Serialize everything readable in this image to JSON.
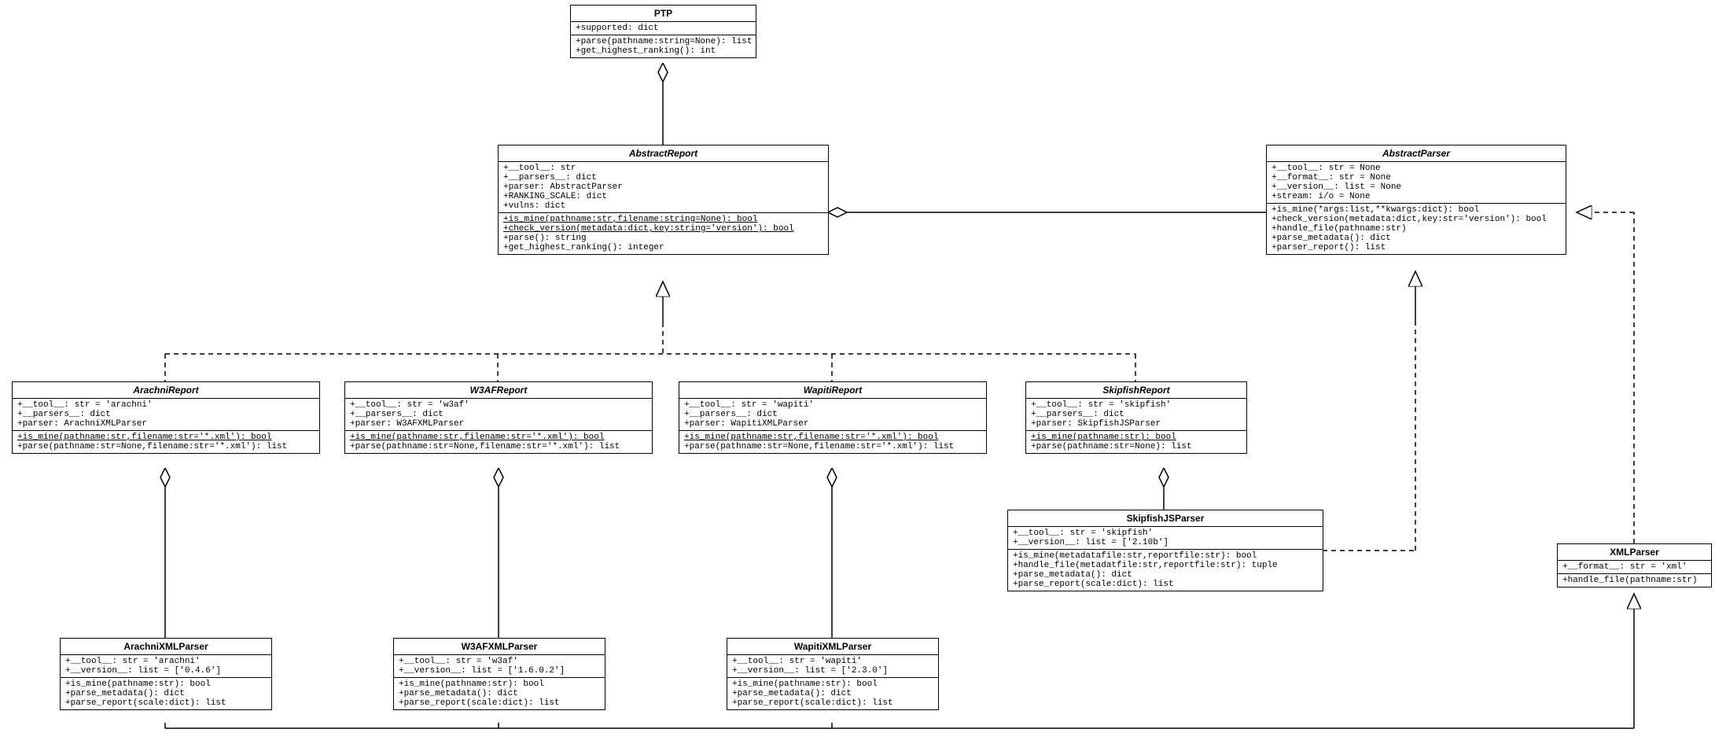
{
  "ptp": {
    "name": "PTP",
    "attrs": "+supported: dict",
    "methods": "+parse(pathname:string=None): list\n+get_highest_ranking(): int"
  },
  "abstractReport": {
    "name": "AbstractReport",
    "attrs": "+__tool__: str\n+__parsers__: dict\n+parser: AbstractParser\n+RANKING_SCALE: dict\n+vulns: dict",
    "methods1": "+is_mine(pathname:str,filename:string=None): bool\n+check_version(metadata:dict,key:string='version'): bool",
    "methods2": "+parse(): string\n+get_highest_ranking(): integer"
  },
  "abstractParser": {
    "name": "AbstractParser",
    "attrs": "+__tool__: str = None\n+__format__: str = None\n+__version__: list = None\n+stream: i/o = None",
    "methods": "+is_mine(*args:list,**kwargs:dict): bool\n+check_version(metadata:dict,key:str='version'): bool\n+handle_file(pathname:str)\n+parse_metadata(): dict\n+parser_report(): list"
  },
  "arachniReport": {
    "name": "ArachniReport",
    "attrs": "+__tool__: str = 'arachni'\n+__parsers__: dict\n+parser: ArachniXMLParser",
    "method1": "+is_mine(pathname:str,filename:str='*.xml'): bool",
    "method2": "+parse(pathname:str=None,filename:str='*.xml'): list"
  },
  "w3afReport": {
    "name": "W3AFReport",
    "attrs": "+__tool__: str = 'w3af'\n+__parsers__: dict\n+parser: W3AFXMLParser",
    "method1": "+is_mine(pathname:str,filename:str='*.xml'): bool",
    "method2": "+parse(pathname:str=None,filename:str='*.xml'): list"
  },
  "wapitiReport": {
    "name": "WapitiReport",
    "attrs": "+__tool__: str = 'wapiti'\n+__parsers__: dict\n+parser: WapitiXMLParser",
    "method1": "+is_mine(pathname:str,filename:str='*.xml'): bool",
    "method2": "+parse(pathname:str=None,filename:str='*.xml'): list"
  },
  "skipfishReport": {
    "name": "SkipfishReport",
    "attrs": "+__tool__: str = 'skipfish'\n+__parsers__: dict\n+parser: SkipfishJSParser",
    "method1": "+is_mine(pathname:str): bool",
    "method2": "+parse(pathname:str=None): list"
  },
  "skipfishJSParser": {
    "name": "SkipfishJSParser",
    "attrs": "+__tool__: str = 'skipfish'\n+__version__: list = ['2.10b']",
    "methods": "+is_mine(metadatafile:str,reportfile:str): bool\n+handle_file(metadatfile:str,reportfile:str): tuple\n+parse_metadata(): dict\n+parse_report(scale:dict): list"
  },
  "xmlParser": {
    "name": "XMLParser",
    "attrs": "+__format__: str = 'xml'",
    "methods": "+handle_file(pathname:str)"
  },
  "arachniXMLParser": {
    "name": "ArachniXMLParser",
    "attrs": "+__tool__: str = 'arachni'\n+__version__: list = ['0.4.6']",
    "methods": "+is_mine(pathname:str): bool\n+parse_metadata(): dict\n+parse_report(scale:dict): list"
  },
  "w3afXMLParser": {
    "name": "W3AFXMLParser",
    "attrs": "+__tool__: str = 'w3af'\n+__version__: list = ['1.6.0.2']",
    "methods": "+is_mine(pathname:str): bool\n+parse_metadata(): dict\n+parse_report(scale:dict): list"
  },
  "wapitiXMLParser": {
    "name": "WapitiXMLParser",
    "attrs": "+__tool__: str = 'wapiti'\n+__version__: list = ['2.3.0']",
    "methods": "+is_mine(pathname:str): bool\n+parse_metadata(): dict\n+parse_report(scale:dict): list"
  }
}
